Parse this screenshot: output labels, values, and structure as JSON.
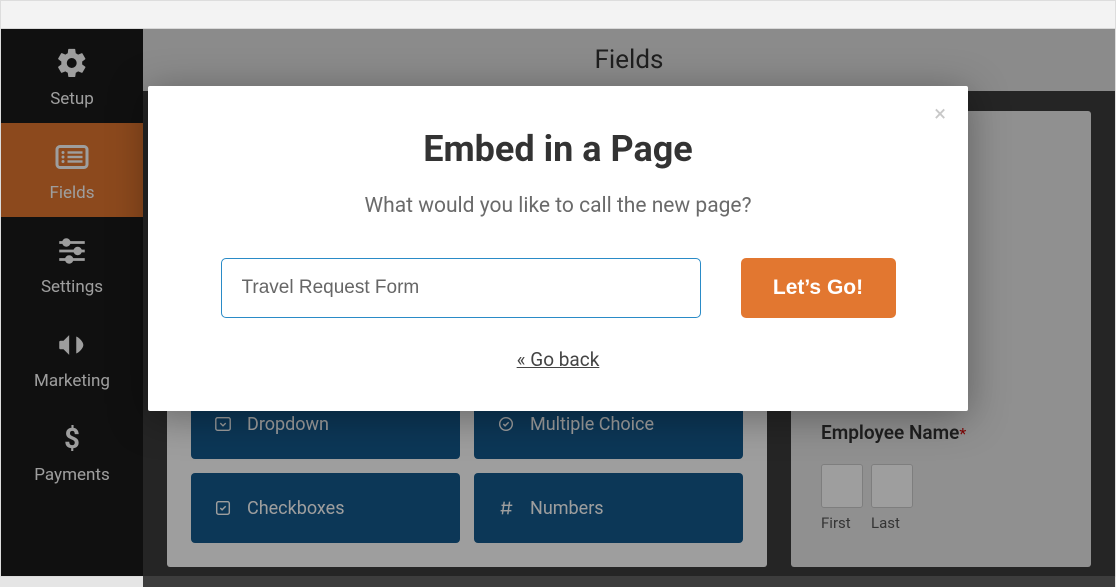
{
  "sidebar": {
    "items": [
      {
        "label": "Setup"
      },
      {
        "label": "Fields"
      },
      {
        "label": "Settings"
      },
      {
        "label": "Marketing"
      },
      {
        "label": "Payments"
      }
    ]
  },
  "section": {
    "title": "Fields"
  },
  "fields": {
    "row1a": "Dropdown",
    "row1b": "Multiple Choice",
    "row2a": "Checkboxes",
    "row2b": "Numbers"
  },
  "preview": {
    "employee_label": "Employee Name",
    "required": "*",
    "first": "First",
    "last": "Last"
  },
  "modal": {
    "title": "Embed in a Page",
    "sub": "What would you like to call the new page?",
    "input_value": "Travel Request Form",
    "button": "Let’s Go!",
    "back": "« Go back"
  }
}
